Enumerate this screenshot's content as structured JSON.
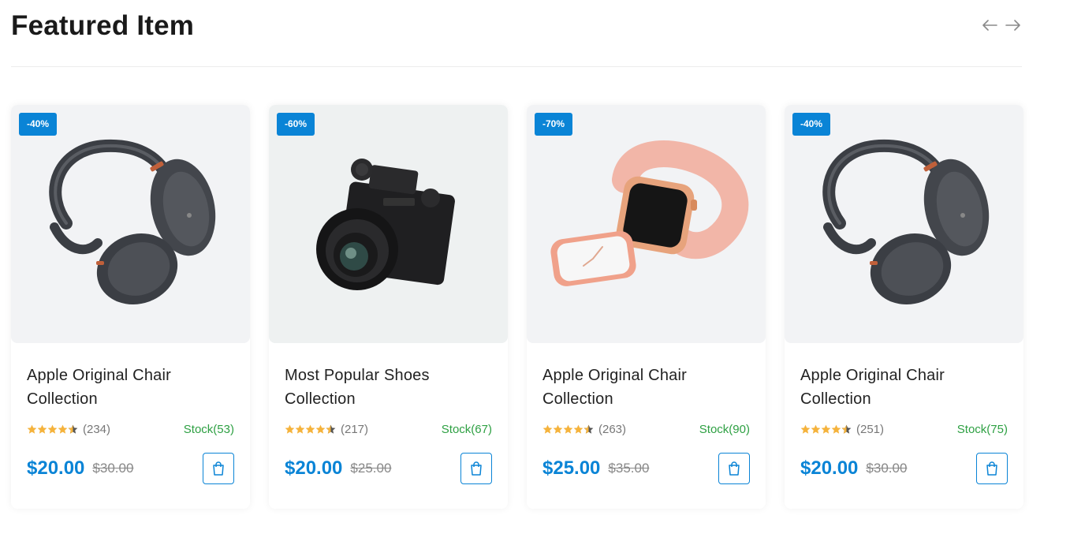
{
  "section": {
    "title": "Featured Item"
  },
  "nav": {
    "prev_icon": "arrow-left-icon",
    "next_icon": "arrow-right-icon"
  },
  "colors": {
    "accent": "#0a84d6",
    "stock": "#2ea043",
    "star": "#f5b33c",
    "star_empty": "#555555"
  },
  "products": [
    {
      "badge": "-40%",
      "image": "headphones",
      "title": "Apple Original Chair Collection",
      "rating": 4.5,
      "reviews": "(234)",
      "stock": "Stock(53)",
      "price": "$20.00",
      "old_price": "$30.00",
      "cart_icon": "shopping-bag-icon"
    },
    {
      "badge": "-60%",
      "image": "camera",
      "title": "Most Popular Shoes Collection",
      "rating": 4.5,
      "reviews": "(217)",
      "stock": "Stock(67)",
      "price": "$20.00",
      "old_price": "$25.00",
      "cart_icon": "shopping-bag-icon"
    },
    {
      "badge": "-70%",
      "image": "smartwatch",
      "title": "Apple Original Chair Collection",
      "rating": 4.5,
      "reviews": "(263)",
      "stock": "Stock(90)",
      "price": "$25.00",
      "old_price": "$35.00",
      "cart_icon": "shopping-bag-icon"
    },
    {
      "badge": "-40%",
      "image": "headphones",
      "title": "Apple Original Chair Collection",
      "rating": 4.5,
      "reviews": "(251)",
      "stock": "Stock(75)",
      "price": "$20.00",
      "old_price": "$30.00",
      "cart_icon": "shopping-bag-icon"
    }
  ]
}
